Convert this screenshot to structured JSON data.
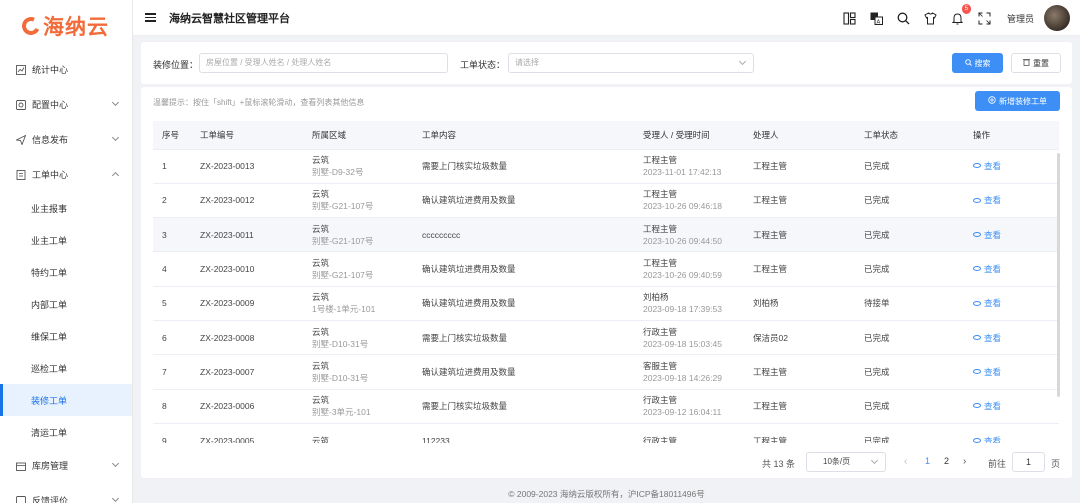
{
  "logo": {
    "text": "海纳云"
  },
  "header": {
    "title": "海纳云智慧社区管理平台",
    "notification_count": "5",
    "user_label": "管理员"
  },
  "sidebar": {
    "items": [
      {
        "label": "统计中心",
        "icon": "chart-icon",
        "expandable": false
      },
      {
        "label": "配置中心",
        "icon": "settings-icon",
        "expandable": true
      },
      {
        "label": "信息发布",
        "icon": "send-icon",
        "expandable": true
      },
      {
        "label": "工单中心",
        "icon": "document-icon",
        "expandable": true,
        "expanded": true
      }
    ],
    "sub_items": [
      "业主报事",
      "业主工单",
      "特约工单",
      "内部工单",
      "维保工单",
      "巡检工单",
      "装修工单",
      "清运工单"
    ],
    "active_sub": "装修工单",
    "bottom_items": [
      {
        "label": "库房管理",
        "icon": "warehouse-icon"
      },
      {
        "label": "反馈评价",
        "icon": "feedback-icon"
      }
    ]
  },
  "filters": {
    "location_label": "装修位置：",
    "location_placeholder": "房屋位置 / 受理人姓名 / 处理人姓名",
    "status_label": "工单状态：",
    "status_placeholder": "请选择",
    "search_label": "搜索",
    "reset_label": "重置"
  },
  "list": {
    "tip": "温馨提示：按住「shift」+鼠标滚轮滑动，查看列表其他信息",
    "add_label": "新增装修工单",
    "columns": [
      "序号",
      "工单编号",
      "所属区域",
      "工单内容",
      "受理人 / 受理时间",
      "处理人",
      "工单状态",
      "操作"
    ],
    "rows": [
      {
        "no": "1",
        "code": "ZX-2023-0013",
        "area": "云筑",
        "area_sub": "别墅-D9-32号",
        "content": "需要上门核实垃圾数量",
        "acceptor": "工程主管",
        "time": "2023-11-01 17:42:13",
        "handler": "工程主管",
        "status": "已完成",
        "action": "查看"
      },
      {
        "no": "2",
        "code": "ZX-2023-0012",
        "area": "云筑",
        "area_sub": "别墅-G21-107号",
        "content": "确认建筑垃进费用及数量",
        "acceptor": "工程主管",
        "time": "2023-10-26 09:46:18",
        "handler": "工程主管",
        "status": "已完成",
        "action": "查看"
      },
      {
        "no": "3",
        "code": "ZX-2023-0011",
        "area": "云筑",
        "area_sub": "别墅-G21-107号",
        "content": "ccccccccc",
        "acceptor": "工程主管",
        "time": "2023-10-26 09:44:50",
        "handler": "工程主管",
        "status": "已完成",
        "action": "查看"
      },
      {
        "no": "4",
        "code": "ZX-2023-0010",
        "area": "云筑",
        "area_sub": "别墅-G21-107号",
        "content": "确认建筑垃进费用及数量",
        "acceptor": "工程主管",
        "time": "2023-10-26 09:40:59",
        "handler": "工程主管",
        "status": "已完成",
        "action": "查看"
      },
      {
        "no": "5",
        "code": "ZX-2023-0009",
        "area": "云筑",
        "area_sub": "1号楼-1单元-101",
        "content": "确认建筑垃进费用及数量",
        "acceptor": "刘柏杨",
        "time": "2023-09-18 17:39:53",
        "handler": "刘柏杨",
        "status": "待接单",
        "action": "查看"
      },
      {
        "no": "6",
        "code": "ZX-2023-0008",
        "area": "云筑",
        "area_sub": "别墅-D10-31号",
        "content": "需要上门核实垃圾数量",
        "acceptor": "行政主管",
        "time": "2023-09-18 15:03:45",
        "handler": "保洁员02",
        "status": "已完成",
        "action": "查看"
      },
      {
        "no": "7",
        "code": "ZX-2023-0007",
        "area": "云筑",
        "area_sub": "别墅-D10-31号",
        "content": "确认建筑垃进费用及数量",
        "acceptor": "客服主管",
        "time": "2023-09-18 14:26:29",
        "handler": "工程主管",
        "status": "已完成",
        "action": "查看"
      },
      {
        "no": "8",
        "code": "ZX-2023-0006",
        "area": "云筑",
        "area_sub": "别墅-3单元-101",
        "content": "需要上门核实垃圾数量",
        "acceptor": "行政主管",
        "time": "2023-09-12 16:04:11",
        "handler": "工程主管",
        "status": "已完成",
        "action": "查看"
      },
      {
        "no": "9",
        "code": "ZX-2023-0005",
        "area": "云筑",
        "area_sub": "",
        "content": "112233",
        "acceptor": "行政主管",
        "time": "",
        "handler": "工程主管",
        "status": "已完成",
        "action": "查看"
      }
    ]
  },
  "pagination": {
    "total": "共 13 条",
    "page_size": "10条/页",
    "pages": [
      "1",
      "2"
    ],
    "current_page": "1",
    "goto_label": "前往",
    "goto_value": "1",
    "page_suffix": "页"
  },
  "footer": {
    "text": "© 2009-2023 海纳云版权所有，沪ICP备18011496号"
  },
  "colors": {
    "brand": "#f26b3a",
    "primary": "#3d8ff5",
    "badge": "#f5564e"
  }
}
